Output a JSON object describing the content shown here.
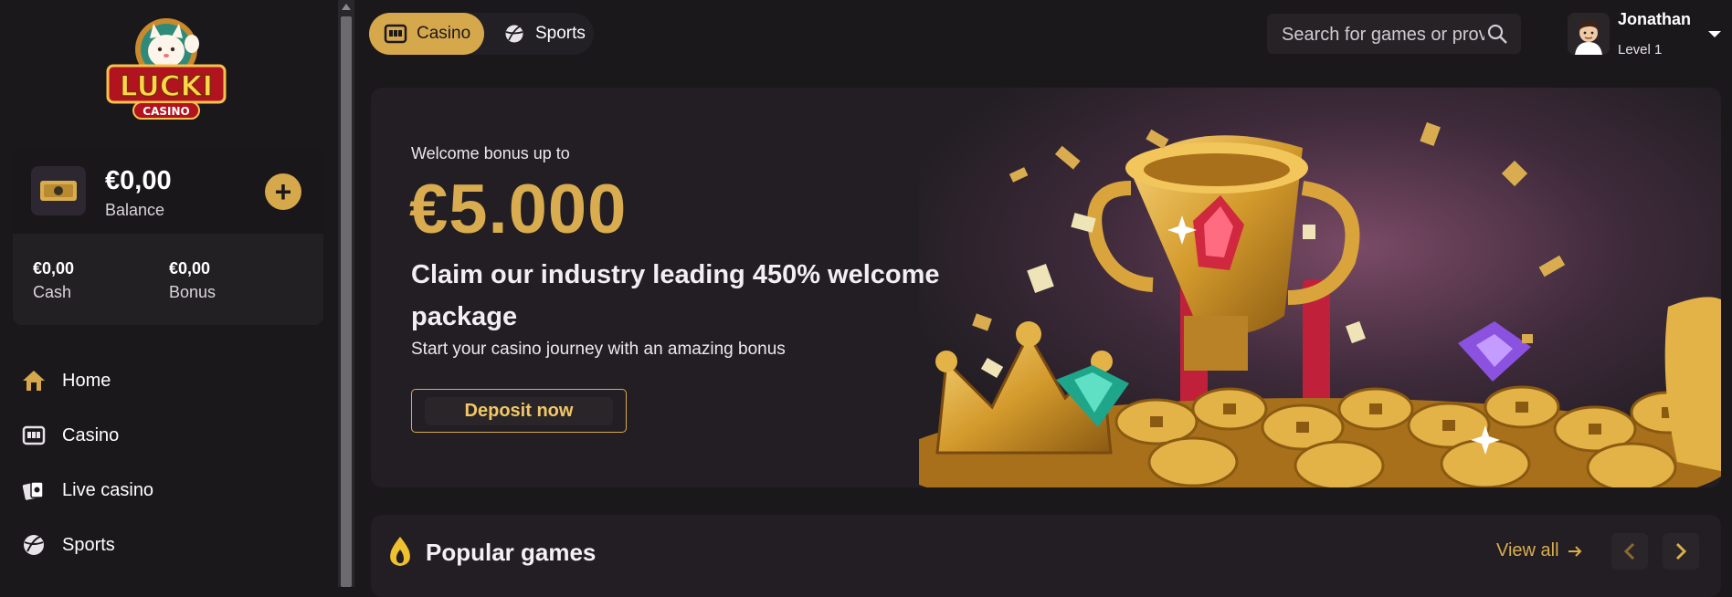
{
  "logo": {
    "brand": "LUCKI",
    "sub": "CASINO"
  },
  "wallet": {
    "balance_amount": "€0,00",
    "balance_label": "Balance",
    "add_label": "+",
    "cash_amount": "€0,00",
    "cash_label": "Cash",
    "bonus_amount": "€0,00",
    "bonus_label": "Bonus"
  },
  "sidebar": {
    "items": [
      {
        "label": "Home",
        "icon": "home-icon"
      },
      {
        "label": "Casino",
        "icon": "slot-machine-icon"
      },
      {
        "label": "Live casino",
        "icon": "cards-icon"
      },
      {
        "label": "Sports",
        "icon": "sports-ball-icon"
      }
    ]
  },
  "topbar": {
    "tabs": [
      {
        "label": "Casino",
        "icon": "slot-machine-icon",
        "active": true
      },
      {
        "label": "Sports",
        "icon": "sports-ball-icon",
        "active": false
      }
    ],
    "search_placeholder": "Search for games or providers",
    "user_name": "Jonathan",
    "user_level": "Level 1"
  },
  "hero": {
    "kicker": "Welcome bonus up to",
    "amount": "€5.000",
    "title": "Claim our industry leading 450% welcome package",
    "subtitle": "Start your casino journey with an amazing bonus",
    "cta": "Deposit now"
  },
  "popular": {
    "title": "Popular games",
    "view_all": "View all"
  },
  "colors": {
    "accent": "#d6a84c",
    "background": "#1b181c",
    "panel": "#221e23"
  }
}
